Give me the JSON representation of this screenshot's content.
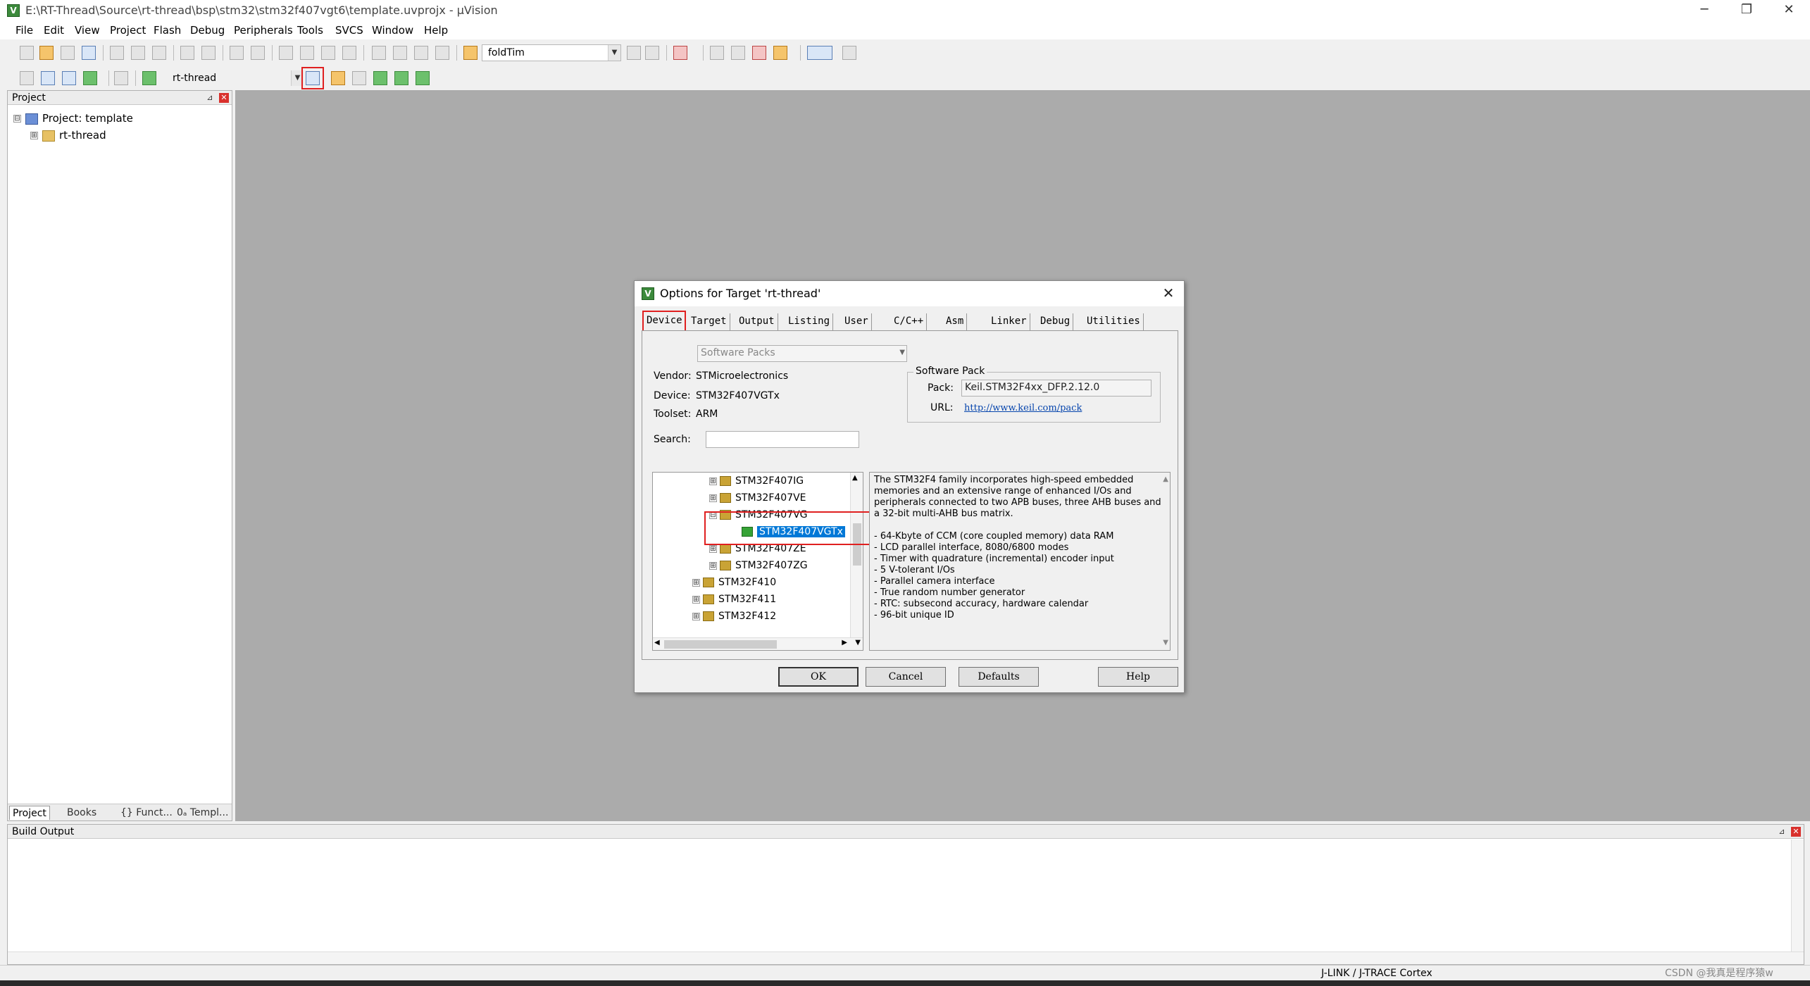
{
  "window": {
    "title": "E:\\RT-Thread\\Source\\rt-thread\\bsp\\stm32\\stm32f407vgt6\\template.uvprojx - µVision",
    "app_icon": "uvision-icon",
    "controls": {
      "minimize": "─",
      "restore": "❐",
      "close": "✕"
    }
  },
  "menu": [
    "File",
    "Edit",
    "View",
    "Project",
    "Flash",
    "Debug",
    "Peripherals",
    "Tools",
    "SVCS",
    "Window",
    "Help"
  ],
  "toolbar1": {
    "find_combo_value": "foldTim"
  },
  "toolbar2": {
    "target_combo_value": "rt-thread"
  },
  "project_panel": {
    "header": "Project",
    "tree": [
      {
        "label": "Project: template",
        "expander": "⊟"
      },
      {
        "label": "rt-thread",
        "expander": "⊞"
      }
    ],
    "tabs": [
      "Project",
      "Books",
      "{} Funct...",
      "0ₐ Templ..."
    ]
  },
  "build_output": {
    "header": "Build Output"
  },
  "status_bar": {
    "debugger": "J-LINK / J-TRACE Cortex",
    "watermark": "CSDN @我真是程序猿w"
  },
  "dialog": {
    "title": "Options for Target 'rt-thread'",
    "tabs": [
      "Device",
      "Target",
      "Output",
      "Listing",
      "User",
      "C/C++",
      "Asm",
      "Linker",
      "Debug",
      "Utilities"
    ],
    "active_tab": "Device",
    "pack_select": "Software Packs",
    "vendor_label": "Vendor:",
    "vendor": "STMicroelectronics",
    "device_label": "Device:",
    "device": "STM32F407VGTx",
    "toolset_label": "Toolset:",
    "toolset": "ARM",
    "search_label": "Search:",
    "search_value": "",
    "software_pack": {
      "group_title": "Software Pack",
      "pack_label": "Pack:",
      "pack": "Keil.STM32F4xx_DFP.2.12.0",
      "url_label": "URL:",
      "url": "http://www.keil.com/pack"
    },
    "device_tree": [
      {
        "label": "STM32F407IG",
        "indent": 2,
        "expander": "⊞",
        "icon": "star"
      },
      {
        "label": "STM32F407VE",
        "indent": 2,
        "expander": "⊞",
        "icon": "star"
      },
      {
        "label": "STM32F407VG",
        "indent": 2,
        "expander": "⊟",
        "icon": "star"
      },
      {
        "label": "STM32F407VGTx",
        "indent": 3,
        "expander": "",
        "icon": "chip",
        "selected": true
      },
      {
        "label": "STM32F407ZE",
        "indent": 2,
        "expander": "⊞",
        "icon": "star"
      },
      {
        "label": "STM32F407ZG",
        "indent": 2,
        "expander": "⊞",
        "icon": "star"
      },
      {
        "label": "STM32F410",
        "indent": 1,
        "expander": "⊞",
        "icon": "star"
      },
      {
        "label": "STM32F411",
        "indent": 1,
        "expander": "⊞",
        "icon": "star"
      },
      {
        "label": "STM32F412",
        "indent": 1,
        "expander": "⊞",
        "icon": "star"
      }
    ],
    "description": {
      "intro": "The STM32F4 family incorporates high-speed embedded memories and an extensive range of enhanced I/Os and peripherals connected to two APB buses, three AHB buses and a 32-bit multi-AHB bus matrix.",
      "features": [
        "- 64-Kbyte of CCM (core coupled memory) data RAM",
        "- LCD parallel interface, 8080/6800 modes",
        "- Timer with quadrature (incremental) encoder input",
        "- 5 V-tolerant I/Os",
        "- Parallel camera interface",
        "- True random number generator",
        "- RTC: subsecond accuracy, hardware calendar",
        "- 96-bit unique ID"
      ]
    },
    "buttons": {
      "ok": "OK",
      "cancel": "Cancel",
      "defaults": "Defaults",
      "help": "Help"
    }
  },
  "colors": {
    "highlight": "#e02020",
    "selection": "#0078d7",
    "workspace": "#ababab"
  }
}
